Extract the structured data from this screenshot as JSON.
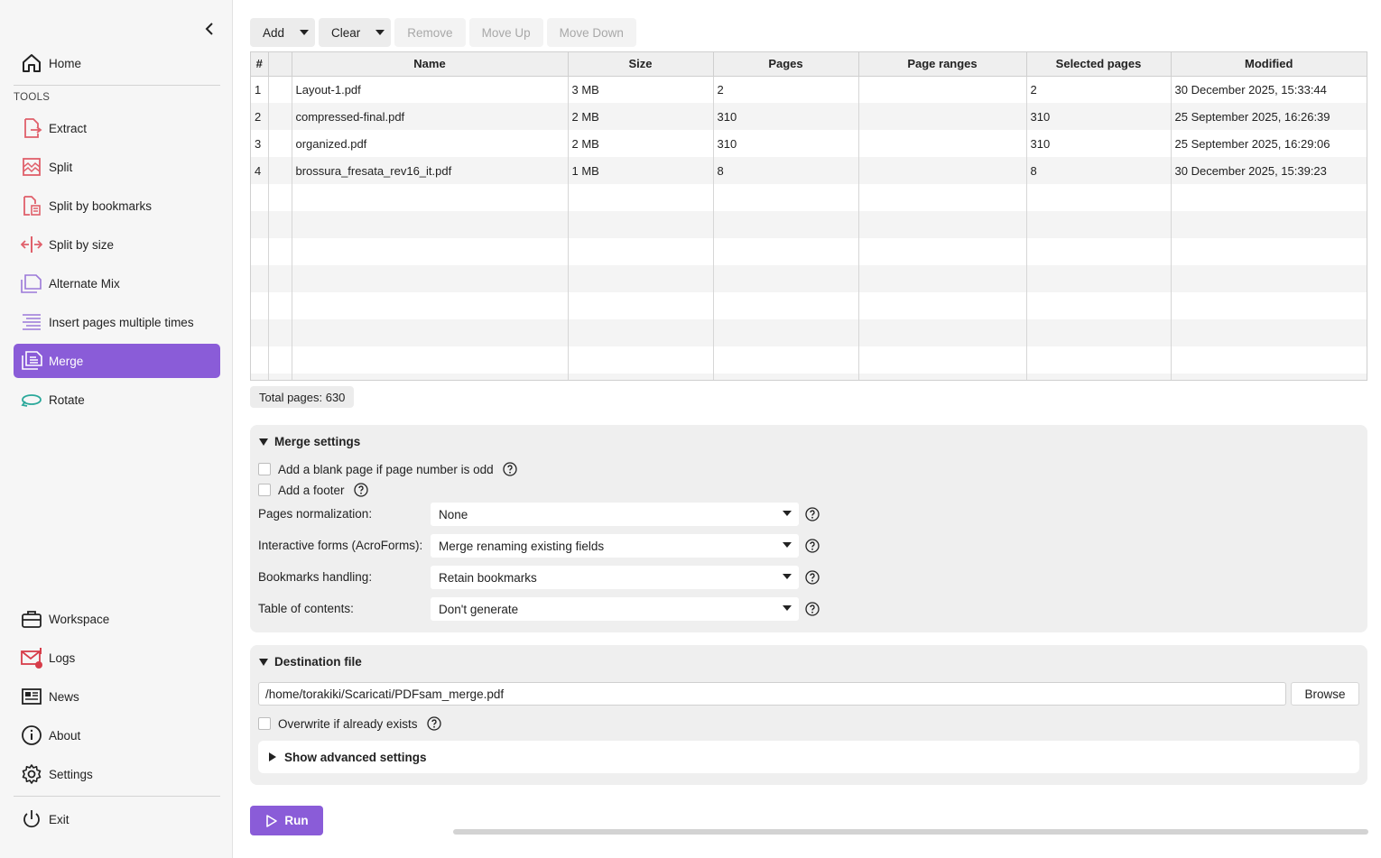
{
  "sidebar": {
    "top": [
      {
        "label": "Home",
        "icon": "home-icon"
      }
    ],
    "tools_label": "TOOLS",
    "tools": [
      {
        "label": "Extract",
        "icon": "extract-icon"
      },
      {
        "label": "Split",
        "icon": "split-icon"
      },
      {
        "label": "Split by bookmarks",
        "icon": "split-bookmarks-icon"
      },
      {
        "label": "Split by size",
        "icon": "split-size-icon"
      },
      {
        "label": "Alternate Mix",
        "icon": "alternate-mix-icon"
      },
      {
        "label": "Insert pages multiple times",
        "icon": "insert-pages-icon"
      },
      {
        "label": "Merge",
        "icon": "merge-icon",
        "active": true
      },
      {
        "label": "Rotate",
        "icon": "rotate-icon"
      }
    ],
    "bottom": [
      {
        "label": "Workspace",
        "icon": "briefcase-icon"
      },
      {
        "label": "Logs",
        "icon": "logs-icon"
      },
      {
        "label": "News",
        "icon": "news-icon"
      },
      {
        "label": "About",
        "icon": "info-icon"
      },
      {
        "label": "Settings",
        "icon": "gear-icon"
      }
    ],
    "exit": {
      "label": "Exit",
      "icon": "power-icon"
    },
    "accent": "#8a5cd8"
  },
  "toolbar": {
    "add": "Add",
    "clear": "Clear",
    "remove": "Remove",
    "move_up": "Move Up",
    "move_down": "Move Down"
  },
  "table": {
    "headers": [
      "#",
      "",
      "Name",
      "Size",
      "Pages",
      "Page ranges",
      "Selected pages",
      "Modified"
    ],
    "rows": [
      [
        "1",
        "",
        "Layout-1.pdf",
        "3 MB",
        "2",
        "",
        "2",
        "30 December 2025, 15:33:44"
      ],
      [
        "2",
        "",
        "compressed-final.pdf",
        "2 MB",
        "310",
        "",
        "310",
        "25 September 2025, 16:26:39"
      ],
      [
        "3",
        "",
        "organized.pdf",
        "2 MB",
        "310",
        "",
        "310",
        "25 September 2025, 16:29:06"
      ],
      [
        "4",
        "",
        "brossura_fresata_rev16_it.pdf",
        "1 MB",
        "8",
        "",
        "8",
        "30 December 2025, 15:39:23"
      ]
    ]
  },
  "total_pages": "Total pages: 630",
  "merge_settings": {
    "title": "Merge settings",
    "blank_page": "Add a blank page if page number is odd",
    "footer": "Add a footer",
    "normalization_label": "Pages normalization:",
    "normalization_value": "None",
    "forms_label": "Interactive forms (AcroForms):",
    "forms_value": "Merge renaming existing fields",
    "bookmarks_label": "Bookmarks handling:",
    "bookmarks_value": "Retain bookmarks",
    "toc_label": "Table of contents:",
    "toc_value": "Don't generate"
  },
  "destination": {
    "title": "Destination file",
    "path": "/home/torakiki/Scaricati/PDFsam_merge.pdf",
    "browse": "Browse",
    "overwrite": "Overwrite if already exists",
    "advanced": "Show advanced settings"
  },
  "run": "Run"
}
